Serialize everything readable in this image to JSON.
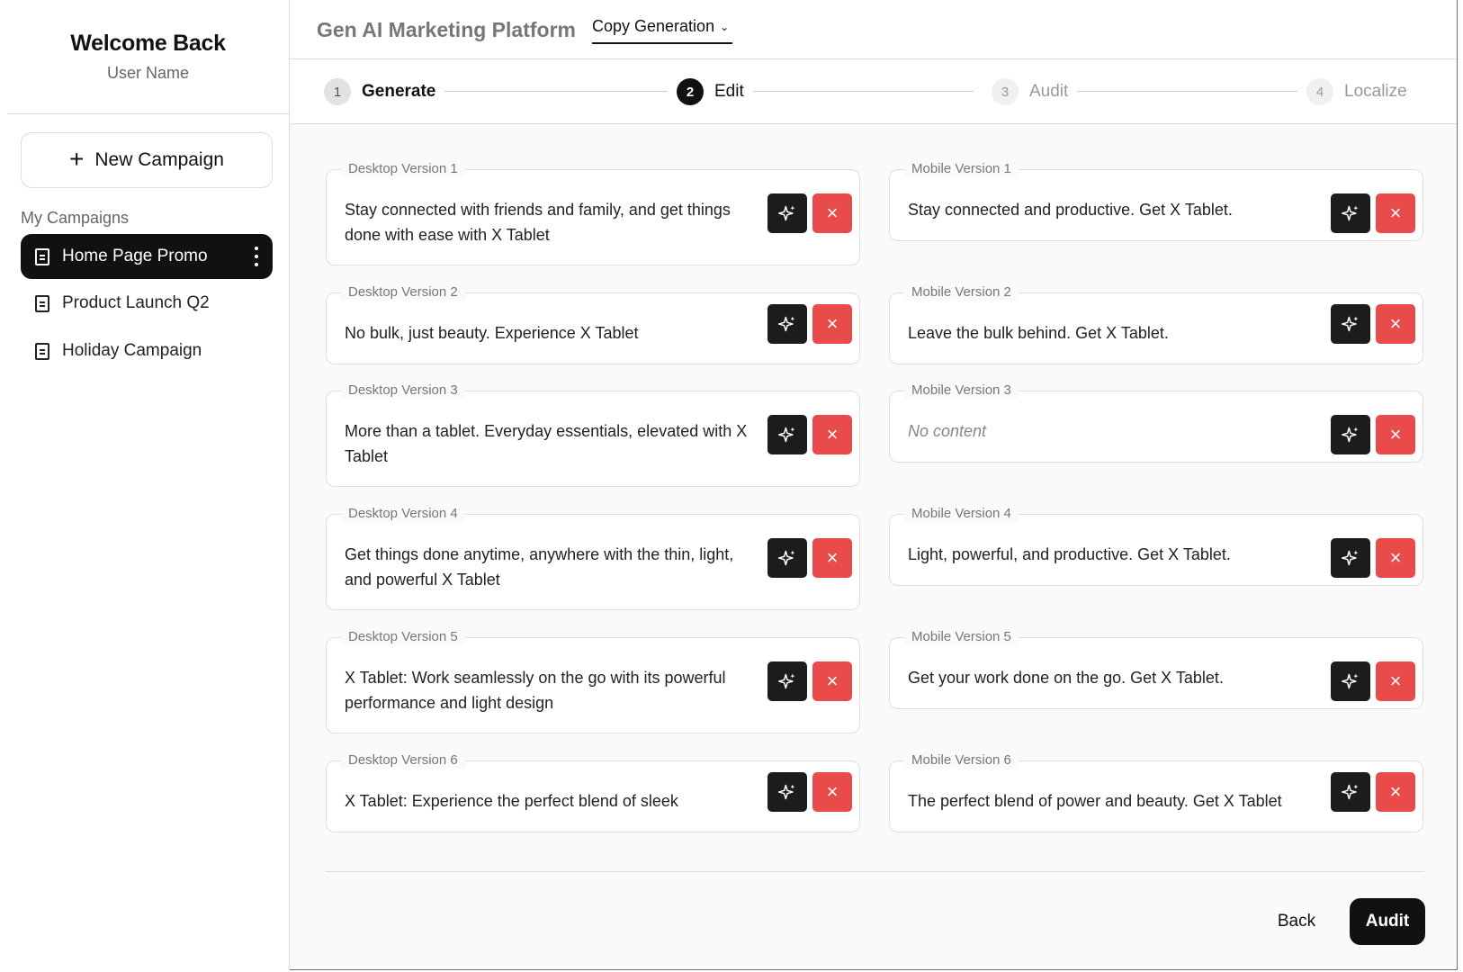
{
  "sidebar": {
    "title": "Welcome Back",
    "user": "User Name",
    "new_campaign_label": "New Campaign",
    "section_label": "My Campaigns",
    "campaigns": [
      {
        "label": "Home Page Promo",
        "active": true
      },
      {
        "label": "Product Launch Q2",
        "active": false
      },
      {
        "label": "Holiday Campaign",
        "active": false
      }
    ]
  },
  "header": {
    "app_title": "Gen AI Marketing Platform",
    "mode_dropdown": "Copy Generation"
  },
  "stepper": [
    {
      "num": "1",
      "label": "Generate",
      "state": "done"
    },
    {
      "num": "2",
      "label": "Edit",
      "state": "current"
    },
    {
      "num": "3",
      "label": "Audit",
      "state": "pending"
    },
    {
      "num": "4",
      "label": "Localize",
      "state": "pending"
    }
  ],
  "desktop_versions": [
    {
      "label": "Desktop Version 1",
      "text": "Stay connected with friends and family, and get things done with ease with X Tablet"
    },
    {
      "label": "Desktop Version 2",
      "text": "No bulk, just beauty. Experience X Tablet"
    },
    {
      "label": "Desktop Version 3",
      "text": "More than a tablet. Everyday essentials, elevated with X Tablet"
    },
    {
      "label": "Desktop Version 4",
      "text": "Get things done anytime, anywhere with the thin, light, and powerful X Tablet"
    },
    {
      "label": "Desktop Version 5",
      "text": "X Tablet: Work seamlessly on the go with its powerful performance and light design"
    },
    {
      "label": "Desktop Version 6",
      "text": "X Tablet: Experience the perfect blend of sleek"
    }
  ],
  "mobile_versions": [
    {
      "label": "Mobile Version 1",
      "text": "Stay connected and productive. Get X Tablet."
    },
    {
      "label": "Mobile Version 2",
      "text": "Leave the bulk behind. Get X Tablet."
    },
    {
      "label": "Mobile Version 3",
      "text": "No content"
    },
    {
      "label": "Mobile Version 4",
      "text": "Light, powerful, and productive. Get X Tablet."
    },
    {
      "label": "Mobile Version 5",
      "text": "Get your work done on the go. Get X Tablet."
    },
    {
      "label": "Mobile Version 6",
      "text": "The perfect blend of power and beauty. Get X Tablet"
    }
  ],
  "footer": {
    "back_label": "Back",
    "audit_label": "Audit"
  },
  "icons": {
    "card_ai_button": "sparkle-icon",
    "card_delete_button": "close-icon",
    "campaign_item": "document-icon",
    "active_campaign_menu": "more-vertical-icon",
    "new_campaign": "plus-icon",
    "dropdown": "chevron-down-icon"
  },
  "colors": {
    "primary": "#111111",
    "delete": "#e94a4a",
    "muted_text": "#777777"
  }
}
